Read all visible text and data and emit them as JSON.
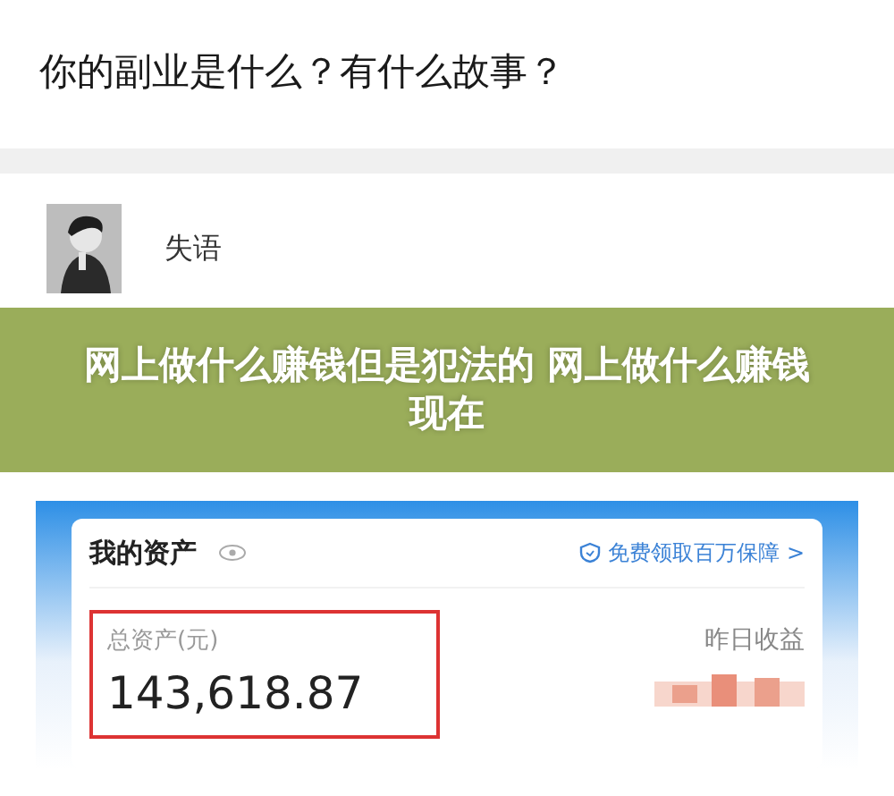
{
  "question": {
    "title": "你的副业是什么？有什么故事？"
  },
  "answer": {
    "author": "失语"
  },
  "banner": {
    "text": "网上做什么赚钱但是犯法的 网上做什么赚钱现在"
  },
  "asset_card": {
    "title": "我的资产",
    "promo_link": "免费领取百万保障 >",
    "total_label": "总资产(元)",
    "total_value": "143,618.87",
    "yesterday_label": "昨日收益"
  }
}
